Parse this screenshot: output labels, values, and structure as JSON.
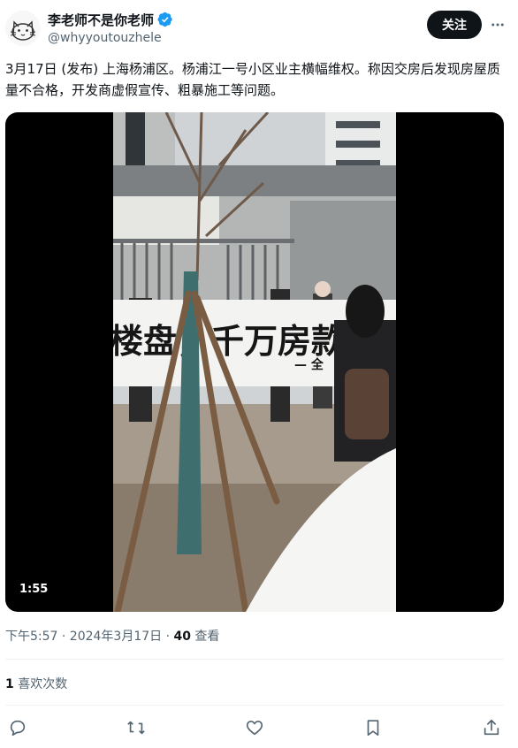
{
  "author": {
    "display_name": "李老师不是你老师",
    "handle": "@whyyoutouzhele",
    "verified": true,
    "avatar_icon": "cat-sketch-avatar"
  },
  "follow_label": "关注",
  "more_icon": "more-dots-icon",
  "tweet_text": "3月17日 (发布) 上海杨浦区。杨浦江一号小区业主横幅维权。称因交房后发现房屋质量不合格，开发商虚假宣传、粗暴施工等问题。",
  "video": {
    "duration": "1:55",
    "banner_text": "楼盘，千万房款泪",
    "banner_sub": "— 全"
  },
  "meta": {
    "time": "下午5:57 · 2024年3月17日 · ",
    "views_count": "40",
    "views_label": " 查看"
  },
  "likes": {
    "count": "1",
    "label": " 喜欢次数"
  },
  "actions": [
    "reply-icon",
    "retweet-icon",
    "like-icon",
    "bookmark-icon",
    "share-icon"
  ],
  "colors": {
    "text": "#0f1419",
    "secondary": "#536471",
    "verified": "#1d9bf0",
    "divider": "#eff3f4"
  }
}
